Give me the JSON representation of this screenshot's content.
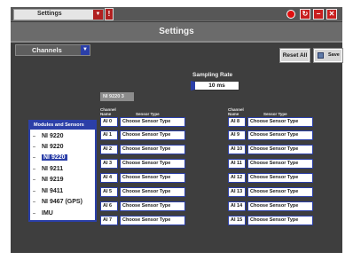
{
  "topbar": {
    "page_select": "Settings",
    "alert_glyph": "!",
    "status_color": "#e01010",
    "buttons": [
      {
        "name": "refresh-icon",
        "glyph": "↻"
      },
      {
        "name": "minimize-icon",
        "glyph": "−"
      },
      {
        "name": "close-icon",
        "glyph": "✕"
      }
    ]
  },
  "title": "Settings",
  "channels_select": "Channels",
  "actions": {
    "reset": "Reset All",
    "save": "Save"
  },
  "sampling": {
    "label": "Sampling Rate",
    "value": "10 ms"
  },
  "device_label": "NI 9220 3",
  "modules": {
    "header": "Modules and Sensors",
    "items": [
      {
        "label": "NI 9220",
        "selected": false
      },
      {
        "label": "NI 9220",
        "selected": false
      },
      {
        "label": "NI 9220",
        "selected": true
      },
      {
        "label": "NI 9211",
        "selected": false
      },
      {
        "label": "NI 9219",
        "selected": false
      },
      {
        "label": "NI 9411",
        "selected": false
      },
      {
        "label": "NI 9467 (GPS)",
        "selected": false
      },
      {
        "label": "IMU",
        "selected": false
      }
    ]
  },
  "table_headers": {
    "channel": "Channel",
    "name": "Name",
    "sensor_type": "Sensor Type"
  },
  "left_channels": [
    {
      "id": "AI 0",
      "type": "Choose Sensor Type"
    },
    {
      "id": "AI 1",
      "type": "Choose Sensor Type"
    },
    {
      "id": "AI 2",
      "type": "Choose Sensor Type"
    },
    {
      "id": "AI 3",
      "type": "Choose Sensor Type"
    },
    {
      "id": "AI 4",
      "type": "Choose Sensor Type"
    },
    {
      "id": "AI 5",
      "type": "Choose Sensor Type"
    },
    {
      "id": "AI 6",
      "type": "Choose Sensor Type"
    },
    {
      "id": "AI 7",
      "type": "Choose Sensor Type"
    }
  ],
  "right_channels": [
    {
      "id": "AI 8",
      "type": "Choose Sensor Type"
    },
    {
      "id": "AI 9",
      "type": "Choose Sensor Type"
    },
    {
      "id": "AI 10",
      "type": "Choose Sensor Type"
    },
    {
      "id": "AI 11",
      "type": "Choose Sensor Type"
    },
    {
      "id": "AI 12",
      "type": "Choose Sensor Type"
    },
    {
      "id": "AI 13",
      "type": "Choose Sensor Type"
    },
    {
      "id": "AI 14",
      "type": "Choose Sensor Type"
    },
    {
      "id": "AI 15",
      "type": "Choose Sensor Type"
    }
  ],
  "colors": {
    "accent": "#2b3fa8",
    "alert": "#c81e1e",
    "background": "#3e3e3e"
  }
}
